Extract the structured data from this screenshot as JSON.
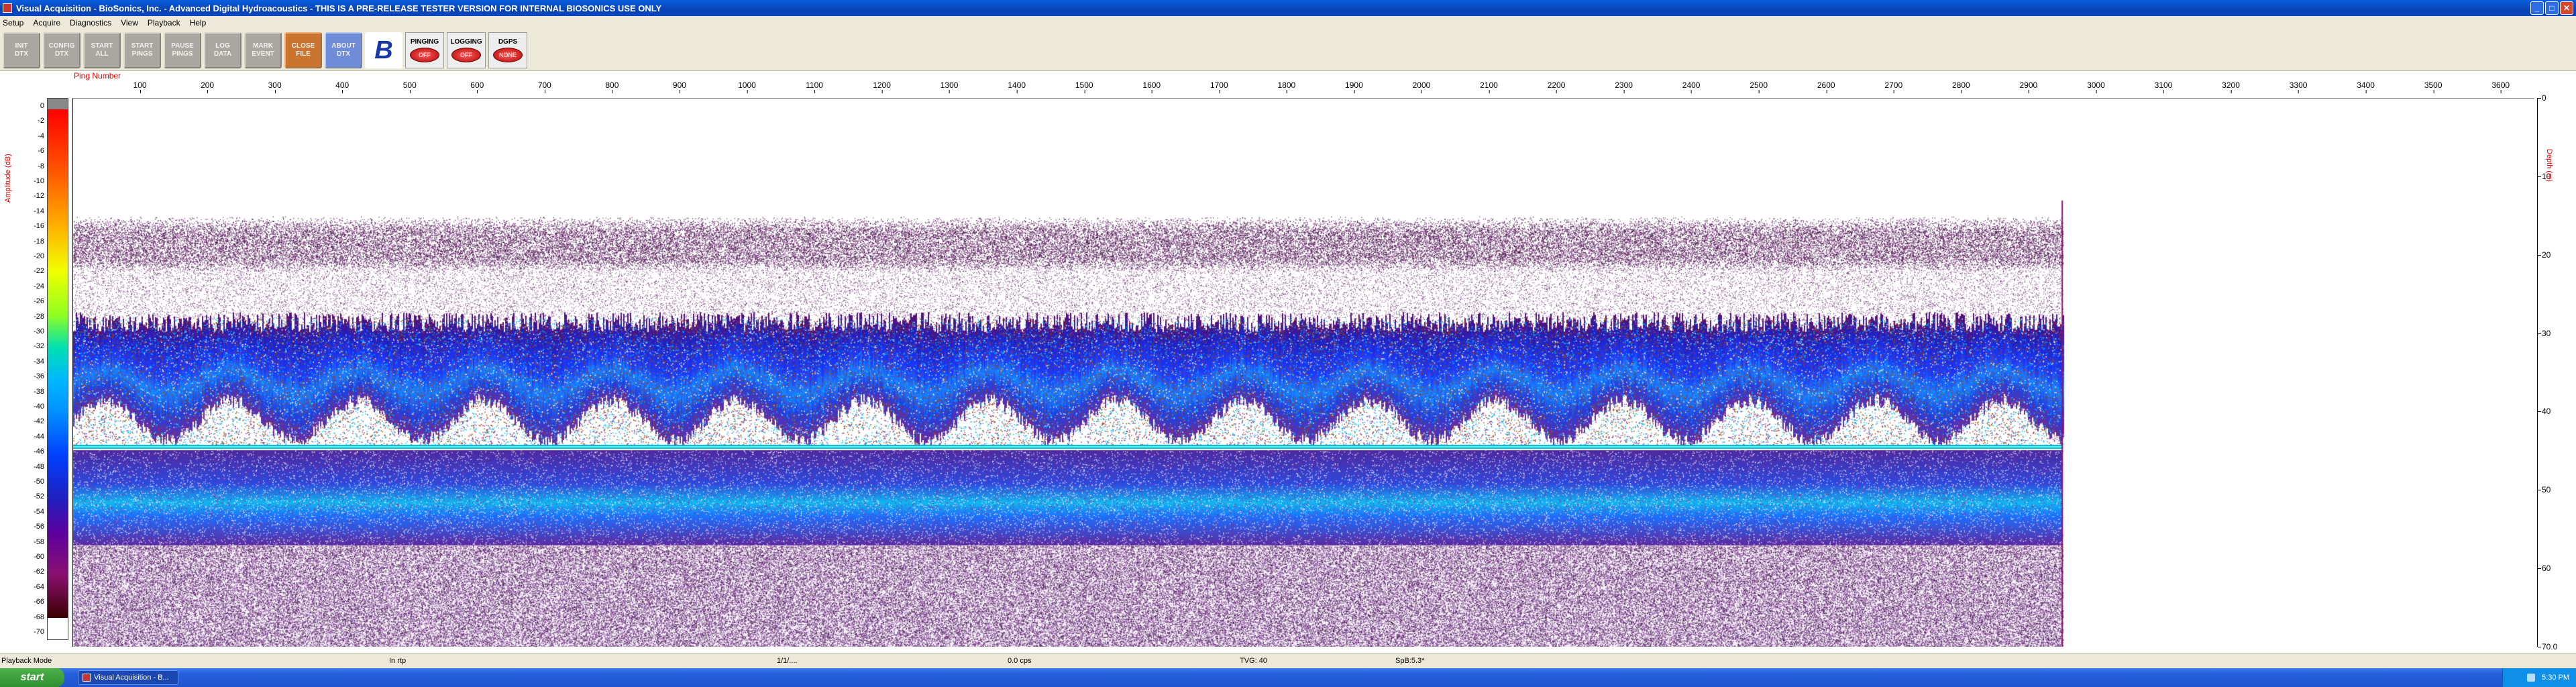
{
  "window": {
    "title": "Visual Acquisition  -  BioSonics, Inc.  -  Advanced Digital Hydroacoustics  -  THIS IS A PRE-RELEASE TESTER VERSION FOR INTERNAL BIOSONICS USE ONLY",
    "buttons": {
      "minimize": "_",
      "maximize": "□",
      "close": "✕"
    }
  },
  "menu": [
    "Setup",
    "Acquire",
    "Diagnostics",
    "View",
    "Playback",
    "Help"
  ],
  "toolbar": {
    "buttons": [
      {
        "label": "INIT\nDTX",
        "style": "gray"
      },
      {
        "label": "CONFIG\nDTX",
        "style": "gray"
      },
      {
        "label": "START\nALL",
        "style": "gray"
      },
      {
        "label": "START\nPINGS",
        "style": "gray"
      },
      {
        "label": "PAUSE\nPINGS",
        "style": "gray"
      },
      {
        "label": "LOG\nDATA",
        "style": "gray"
      },
      {
        "label": "MARK\nEVENT",
        "style": "gray"
      },
      {
        "label": "CLOSE\nFILE",
        "style": "orange"
      },
      {
        "label": "ABOUT\nDTX",
        "style": "blue"
      }
    ],
    "logo_glyph": "B",
    "indicators": [
      {
        "label": "PINGING",
        "state": "OFF"
      },
      {
        "label": "LOGGING",
        "state": "OFF"
      },
      {
        "label": "DGPS",
        "state": "NONE"
      }
    ]
  },
  "echogram": {
    "x_axis_title": "Ping Number",
    "x_ticks": [
      "100",
      "200",
      "300",
      "400",
      "500",
      "600",
      "700",
      "800",
      "900",
      "1000",
      "1100",
      "1200",
      "1300",
      "1400",
      "1500",
      "1600",
      "1700",
      "1800",
      "1900",
      "2000",
      "2100",
      "2200",
      "2300",
      "2400",
      "2500",
      "2600",
      "2700",
      "2800",
      "2900",
      "3000",
      "3100",
      "3200",
      "3300",
      "3400",
      "3500",
      "3600"
    ],
    "x_range": [
      0,
      3650
    ],
    "data_extent_pings": 2950,
    "amplitude_label": "Amplitude (dB)",
    "amplitude_ticks": [
      "0",
      "-2",
      "-4",
      "-6",
      "-8",
      "-10",
      "-12",
      "-14",
      "-16",
      "-18",
      "-20",
      "-22",
      "-24",
      "-26",
      "-28",
      "-30",
      "-32",
      "-34",
      "-36",
      "-38",
      "-40",
      "-42",
      "-44",
      "-46",
      "-48",
      "-50",
      "-52",
      "-54",
      "-56",
      "-58",
      "-60",
      "-62",
      "-64",
      "-66",
      "-68",
      "-70"
    ],
    "depth_label": "Depth (m)",
    "depth_ticks": [
      "0",
      "10",
      "20",
      "30",
      "40",
      "50",
      "60",
      "70.0"
    ],
    "depth_range_m": [
      0,
      70
    ],
    "bottom_depth_m": 44.5,
    "colors": {
      "surface_noise": "#3a1040",
      "school": "#1a3cff",
      "bottom": "#00c0e0",
      "sub_bottom": "#6a2aa0"
    }
  },
  "statusbar": {
    "mode": "Playback Mode",
    "cells": [
      "In rtp",
      "1/1/....",
      "0.0 cps",
      "TVG: 40",
      "SpB:5.3*"
    ]
  },
  "taskbar": {
    "start": "start",
    "task": "Visual Acquisition - B...",
    "clock": "5:30 PM"
  }
}
